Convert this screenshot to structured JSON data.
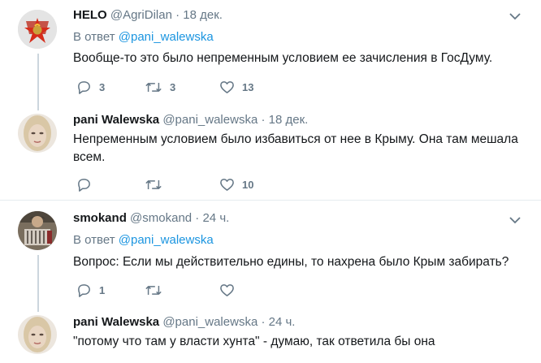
{
  "tweets": [
    {
      "name": "HELO",
      "handle": "@AgriDilan",
      "dot": "·",
      "time": "18 дек.",
      "reply_prefix": "В ответ",
      "reply_handle": "@pani_walewska",
      "text": "Вообще-то это было непременным условием ее зачисления в ГосДуму.",
      "replies": "3",
      "retweets": "3",
      "likes": "13"
    },
    {
      "name": "pani Walewska",
      "handle": "@pani_walewska",
      "dot": "·",
      "time": "18 дек.",
      "text_line1": "Непременным условием было избавиться от нее в Крыму. Она там мешала",
      "text_line2": "всем.",
      "replies": "",
      "retweets": "",
      "likes": "10"
    },
    {
      "name": "smokand",
      "handle": "@smokand",
      "dot": "·",
      "time": "24 ч.",
      "reply_prefix": "В ответ",
      "reply_handle": "@pani_walewska",
      "text": "Вопрос: Если мы действительно едины, то нахрена было Крым забирать?",
      "replies": "1",
      "retweets": "",
      "likes": ""
    },
    {
      "name": "pani Walewska",
      "handle": "@pani_walewska",
      "dot": "·",
      "time": "24 ч.",
      "text": "\"потому что там у власти хунта\" - думаю, так ответила бы она"
    }
  ],
  "colors": {
    "link": "#1b95e0",
    "muted": "#657786",
    "thread_line": "#ccd6dd",
    "divider": "#e6ecf0"
  },
  "icons": [
    "pioneer-badge-avatar",
    "woman-avatar",
    "accordion-player-avatar",
    "chevron-down-icon",
    "reply-icon",
    "retweet-icon",
    "like-icon"
  ]
}
